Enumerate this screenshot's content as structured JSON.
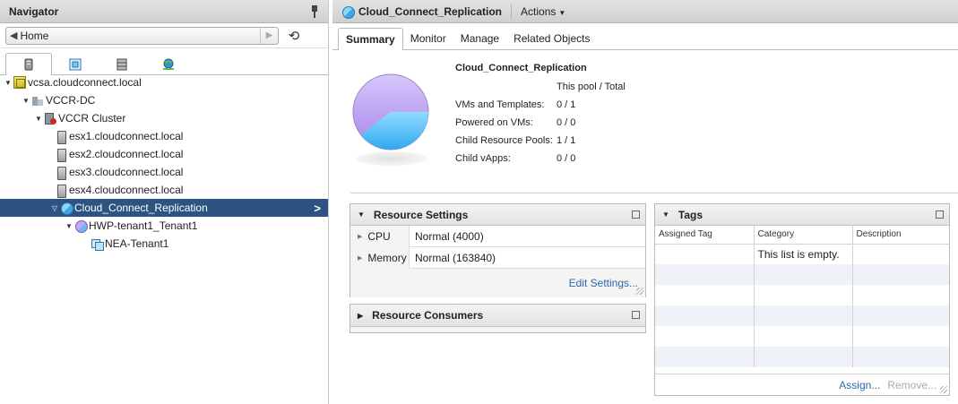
{
  "navigator": {
    "title": "Navigator",
    "home_label": "Home",
    "icon_tabs": [
      {
        "name": "hosts-clusters-tab",
        "icon": "host-icon",
        "active": true
      },
      {
        "name": "vms-templates-tab",
        "icon": "vm-icon",
        "active": false
      },
      {
        "name": "storage-tab",
        "icon": "storage-icon",
        "active": false
      },
      {
        "name": "networking-tab",
        "icon": "network-icon",
        "active": false
      }
    ],
    "tree": [
      {
        "label": "vcsa.cloudconnect.local",
        "level": 0,
        "icon": "vcenter-icon",
        "expanded": true
      },
      {
        "label": "VCCR-DC",
        "level": 1,
        "icon": "datacenter-icon",
        "expanded": true
      },
      {
        "label": "VCCR Cluster",
        "level": 2,
        "icon": "cluster-icon",
        "expanded": true
      },
      {
        "label": "esx1.cloudconnect.local",
        "level": 3,
        "icon": "host-icon"
      },
      {
        "label": "esx2.cloudconnect.local",
        "level": 3,
        "icon": "host-icon"
      },
      {
        "label": "esx3.cloudconnect.local",
        "level": 3,
        "icon": "host-icon"
      },
      {
        "label": "esx4.cloudconnect.local",
        "level": 3,
        "icon": "host-icon"
      },
      {
        "label": "Cloud_Connect_Replication",
        "level": 3,
        "icon": "resource-pool-icon",
        "expanded": true,
        "selected": true
      },
      {
        "label": "HWP-tenant1_Tenant1",
        "level": 4,
        "icon": "resource-pool-icon",
        "expanded": true
      },
      {
        "label": "NEA-Tenant1",
        "level": 5,
        "icon": "vapp-icon"
      }
    ]
  },
  "header": {
    "title": "Cloud_Connect_Replication",
    "actions_label": "Actions"
  },
  "tabs": [
    "Summary",
    "Monitor",
    "Manage",
    "Related Objects"
  ],
  "summary": {
    "title": "Cloud_Connect_Replication",
    "column_header": "This pool / Total",
    "rows": [
      {
        "label": "VMs and Templates:",
        "value": "0 / 1"
      },
      {
        "label": "Powered on VMs:",
        "value": "0 / 0"
      },
      {
        "label": "Child Resource Pools:",
        "value": "1 / 1"
      },
      {
        "label": "Child vApps:",
        "value": "0 / 0"
      }
    ]
  },
  "resource_settings": {
    "title": "Resource Settings",
    "rows": [
      {
        "label": "CPU",
        "value": "Normal (4000)"
      },
      {
        "label": "Memory",
        "value": "Normal (163840)"
      }
    ],
    "edit_link": "Edit Settings..."
  },
  "resource_consumers": {
    "title": "Resource Consumers"
  },
  "tags": {
    "title": "Tags",
    "columns": [
      "Assigned Tag",
      "Category",
      "Description"
    ],
    "empty_message": "This list is empty.",
    "assign_link": "Assign...",
    "remove_link": "Remove..."
  },
  "colors": {
    "selected_row": "#2c5382",
    "link": "#2a68a8",
    "pie_purple": "#b79cf0",
    "pie_blue": "#4fbdf5"
  }
}
